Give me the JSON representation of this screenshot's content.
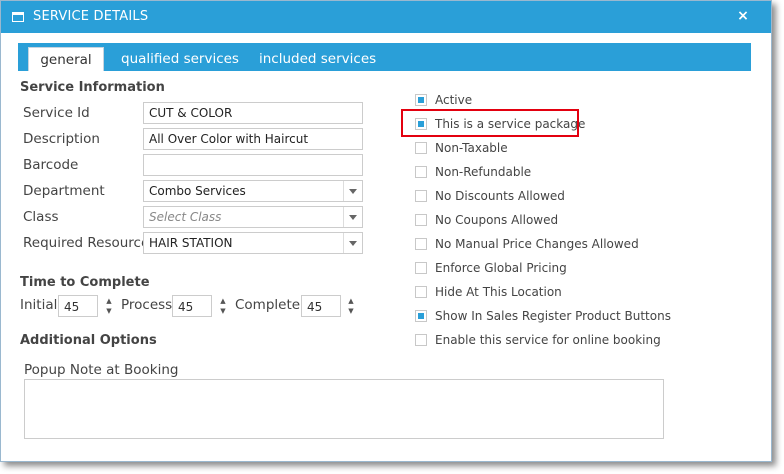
{
  "window": {
    "title": "SERVICE DETAILS",
    "close_label": "×"
  },
  "tabs": [
    {
      "label": "general"
    },
    {
      "label": "qualified services"
    },
    {
      "label": "included services"
    }
  ],
  "service_info": {
    "title": "Service Information",
    "service_id_label": "Service Id",
    "service_id_value": "CUT & COLOR",
    "description_label": "Description",
    "description_value": "All Over Color with Haircut",
    "barcode_label": "Barcode",
    "barcode_value": "",
    "department_label": "Department",
    "department_value": "Combo Services",
    "class_label": "Class",
    "class_placeholder": "Select Class",
    "resource_label": "Required Resource",
    "resource_value": "HAIR STATION"
  },
  "time": {
    "title": "Time to Complete",
    "initial_label": "Initial",
    "initial_value": "45",
    "process_label": "Process",
    "process_value": "45",
    "complete_label": "Complete",
    "complete_value": "45",
    "up_glyph": "▲",
    "down_glyph": "▼"
  },
  "additional": {
    "title": "Additional Options",
    "popup_label": "Popup Note at Booking",
    "popup_value": ""
  },
  "options": [
    {
      "label": "Active",
      "checked": true
    },
    {
      "label": "This is a service package",
      "checked": true
    },
    {
      "label": "Non-Taxable",
      "checked": false
    },
    {
      "label": "Non-Refundable",
      "checked": false
    },
    {
      "label": "No Discounts Allowed",
      "checked": false
    },
    {
      "label": "No Coupons Allowed",
      "checked": false
    },
    {
      "label": "No Manual Price Changes Allowed",
      "checked": false
    },
    {
      "label": "Enforce Global Pricing",
      "checked": false
    },
    {
      "label": "Hide At This Location",
      "checked": false
    },
    {
      "label": "Show In Sales Register Product Buttons",
      "checked": true
    },
    {
      "label": "Enable this service for online booking",
      "checked": false
    }
  ],
  "colors": {
    "accent": "#2a9fd8",
    "highlight": "#e3000f"
  }
}
